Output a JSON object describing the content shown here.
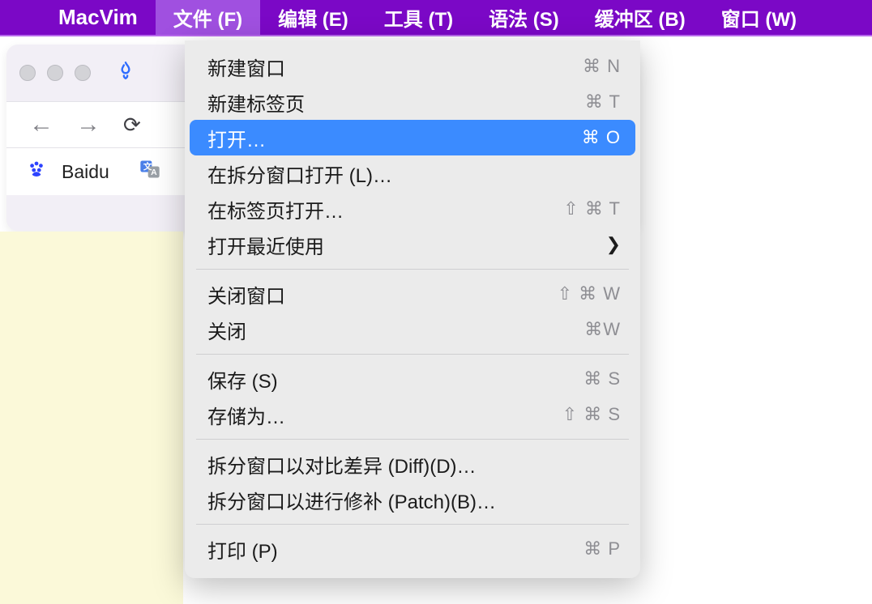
{
  "menubar": {
    "app": "MacVim",
    "items": [
      {
        "label": "文件 (F)",
        "active": true
      },
      {
        "label": "编辑 (E)"
      },
      {
        "label": "工具 (T)"
      },
      {
        "label": "语法 (S)"
      },
      {
        "label": "缓冲区 (B)"
      },
      {
        "label": "窗口 (W)"
      }
    ]
  },
  "bookmarks": {
    "baidu": "Baidu"
  },
  "menu": {
    "items": [
      {
        "label": "新建窗口",
        "shortcut": "⌘ N"
      },
      {
        "label": "新建标签页",
        "shortcut": "⌘ T"
      },
      {
        "label": "打开…",
        "shortcut": "⌘ O",
        "highlight": true
      },
      {
        "label": "在拆分窗口打开 (L)…",
        "shortcut": ""
      },
      {
        "label": "在标签页打开…",
        "shortcut": "⇧ ⌘ T"
      },
      {
        "label": "打开最近使用",
        "submenu": true
      },
      {
        "sep": true
      },
      {
        "label": "关闭窗口",
        "shortcut": "⇧ ⌘ W"
      },
      {
        "label": "关闭",
        "shortcut": "⌘W"
      },
      {
        "sep": true
      },
      {
        "label": "保存 (S)",
        "shortcut": "⌘ S"
      },
      {
        "label": "存储为…",
        "shortcut": "⇧ ⌘ S"
      },
      {
        "sep": true
      },
      {
        "label": "拆分窗口以对比差异 (Diff)(D)…",
        "shortcut": ""
      },
      {
        "label": "拆分窗口以进行修补 (Patch)(B)…",
        "shortcut": ""
      },
      {
        "sep": true
      },
      {
        "label": "打印 (P)",
        "shortcut": "⌘ P"
      }
    ]
  }
}
